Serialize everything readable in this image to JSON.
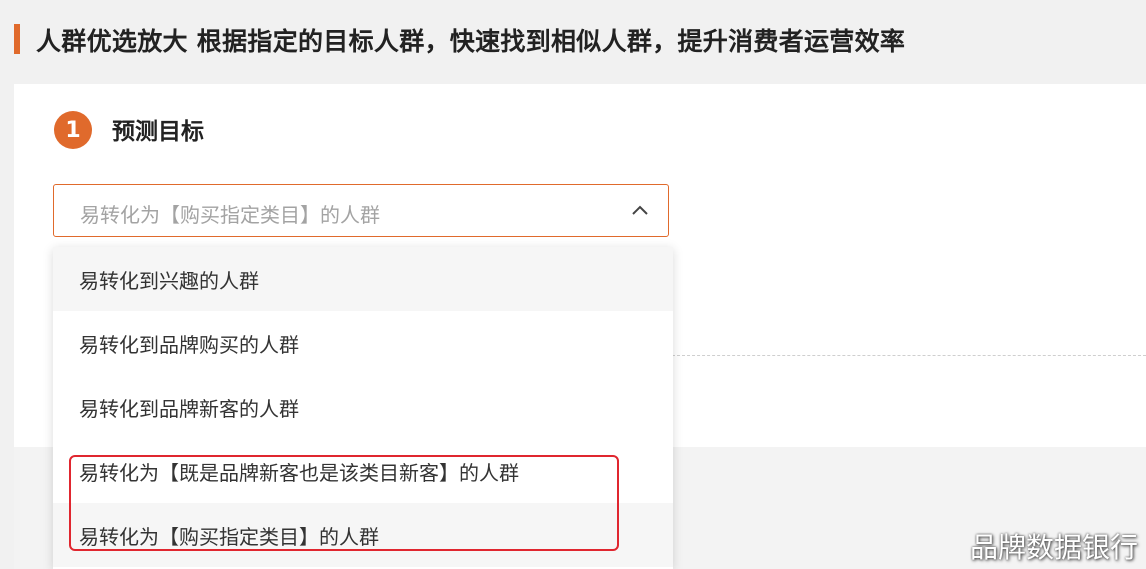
{
  "header": {
    "title": "人群优选放大 根据指定的目标人群，快速找到相似人群，提升消费者运营效率",
    "accent_color": "#e06a2c"
  },
  "step": {
    "number": "1",
    "title": "预测目标"
  },
  "select": {
    "value": "易转化为【购买指定类目】的人群",
    "expanded": true,
    "icon": "chevron-up-icon"
  },
  "dropdown": {
    "options": [
      {
        "label": "易转化到兴趣的人群"
      },
      {
        "label": "易转化到品牌购买的人群"
      },
      {
        "label": "易转化到品牌新客的人群"
      },
      {
        "label": "易转化为【既是品牌新客也是该类目新客】的人群"
      },
      {
        "label": "易转化为【购买指定类目】的人群"
      }
    ],
    "highlight_color": "#e0262f"
  },
  "watermark": "品牌数据银行"
}
